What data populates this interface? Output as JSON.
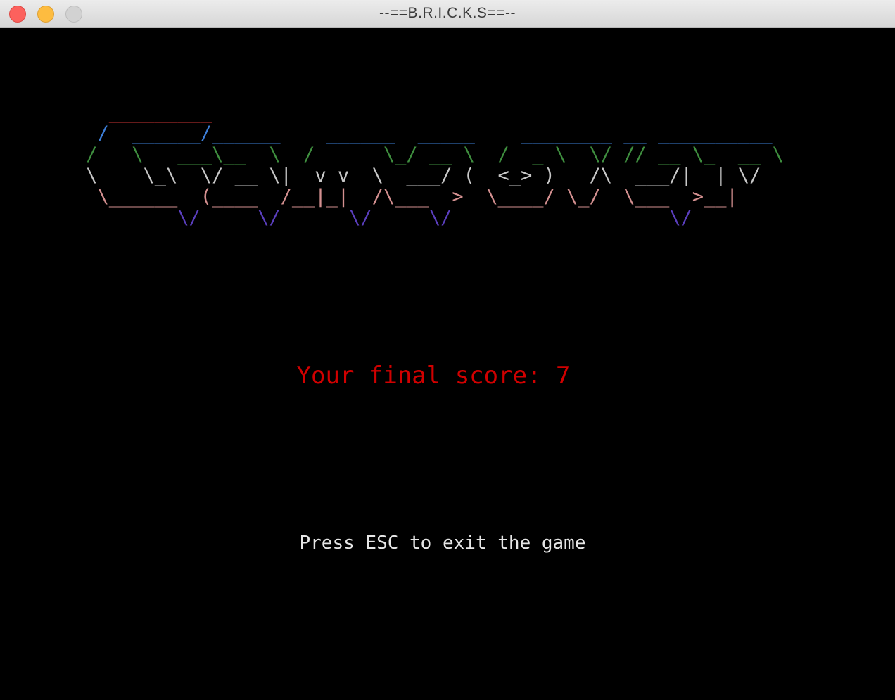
{
  "window": {
    "title": "--==B.R.I.C.K.S==--"
  },
  "banner": {
    "ascii_lines": [
      "   _________",
      "  /  ______/______    ______  _____    ________ __ __________",
      " /   \\   ___\\__  \\  /      \\_/ __ \\  /  _ \\  \\/ // __ \\_  __ \\",
      " \\    \\_\\  \\/ __ \\|  v v  \\  ___/ (  <_> )   /\\  ___/|  | \\/",
      "  \\______  (____  /__|_|  /\\___  >  \\____/ \\_/  \\___  >__|",
      "         \\/     \\/      \\/     \\/                   \\/"
    ],
    "line_colors": [
      "#cc3333",
      "#3d7fd9",
      "#3f8f3f",
      "#c8c8c8",
      "#d49090",
      "#5b3fbf"
    ]
  },
  "game": {
    "score_text": "Your final score: 7",
    "score_color": "#d10000",
    "hint_text": "Press ESC to exit the game"
  }
}
